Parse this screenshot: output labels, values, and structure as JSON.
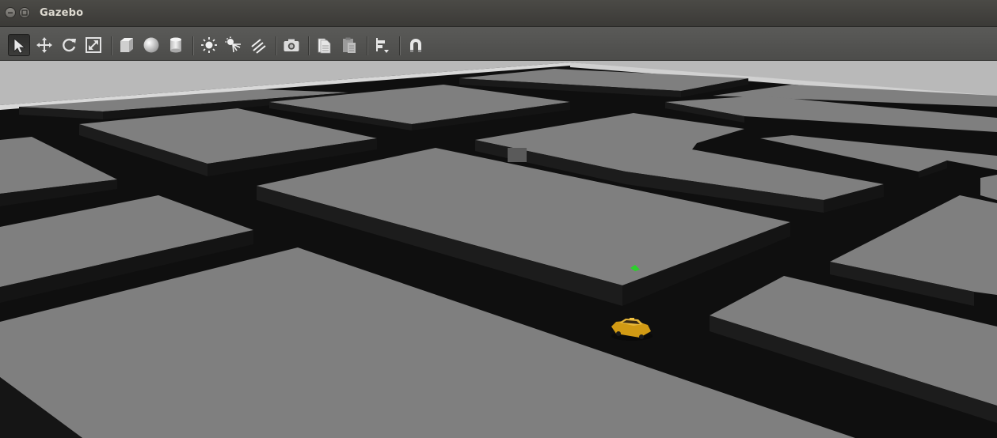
{
  "window": {
    "title": "Gazebo",
    "buttons": [
      "minimize",
      "maximize"
    ]
  },
  "toolbar": {
    "tools": [
      {
        "name": "select-mode",
        "icon": "arrow-pointer-icon",
        "active": true
      },
      {
        "name": "translate-mode",
        "icon": "move-arrows-icon",
        "active": false
      },
      {
        "name": "rotate-mode",
        "icon": "rotate-icon",
        "active": false
      },
      {
        "name": "scale-mode",
        "icon": "scale-icon",
        "active": false
      },
      {
        "name": "insert-box",
        "icon": "box-icon",
        "active": false
      },
      {
        "name": "insert-sphere",
        "icon": "sphere-icon",
        "active": false
      },
      {
        "name": "insert-cylinder",
        "icon": "cylinder-icon",
        "active": false
      },
      {
        "name": "point-light",
        "icon": "point-light-icon",
        "active": false
      },
      {
        "name": "spot-light",
        "icon": "spot-light-icon",
        "active": false
      },
      {
        "name": "directional-light",
        "icon": "directional-light-icon",
        "active": false
      },
      {
        "name": "screenshot",
        "icon": "camera-icon",
        "active": false
      },
      {
        "name": "copy",
        "icon": "copy-icon",
        "active": false
      },
      {
        "name": "paste",
        "icon": "paste-icon",
        "active": false
      },
      {
        "name": "align",
        "icon": "align-icon",
        "active": false
      },
      {
        "name": "snap",
        "icon": "magnet-icon",
        "active": false
      }
    ]
  },
  "scene": {
    "background_color": "#0f0f0f",
    "block_top_color": "#7f7f7f",
    "block_side_color": "#1c1c1c",
    "sky_color": "#b9b9b9",
    "vehicle_color": "#d19a14",
    "marker_color": "#2bd12b"
  }
}
